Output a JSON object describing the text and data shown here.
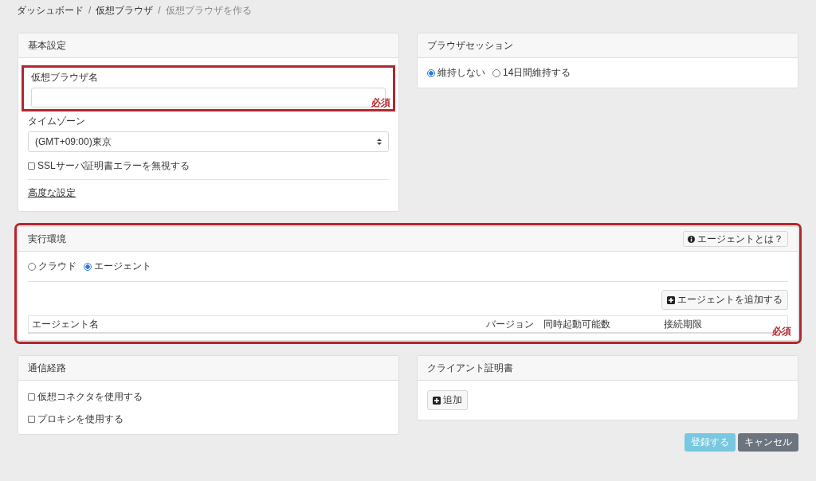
{
  "breadcrumb": {
    "items": [
      {
        "label": "ダッシュボード",
        "link": true
      },
      {
        "label": "仮想ブラウザ",
        "link": true
      },
      {
        "label": "仮想ブラウザを作る",
        "link": false
      }
    ],
    "separators": [
      "/",
      "/"
    ]
  },
  "basic_settings": {
    "title": "基本設定",
    "name_field": {
      "label": "仮想ブラウザ名",
      "highlighted": true,
      "note": "必須"
    },
    "timezone": {
      "label": "タイムゾーン",
      "value": "(GMT+09:00)東京"
    },
    "ignore_ssl": {
      "label": "SSLサーバ証明書エラーを無視する",
      "checked": false
    },
    "advanced_link": "高度な設定"
  },
  "browser_session": {
    "title": "ブラウザセッション",
    "options": [
      {
        "label": "維持しない",
        "selected": true
      },
      {
        "label": "14日間維持する",
        "selected": false
      }
    ]
  },
  "execution_environment": {
    "title": "実行環境",
    "highlighted": true,
    "note": "必須",
    "help_button": "エージェントとは？",
    "options": [
      {
        "label": "クラウド",
        "selected": false
      },
      {
        "label": "エージェント",
        "selected": true
      }
    ],
    "add_button": "エージェントを追加する",
    "columns": [
      "エージェント名",
      "バージョン",
      "同時起動可能数",
      "接続期限"
    ]
  },
  "network_route": {
    "title": "通信経路",
    "options": [
      {
        "label": "仮想コネクタを使用する",
        "checked": false
      },
      {
        "label": "プロキシを使用する",
        "checked": false
      }
    ]
  },
  "client_certificate": {
    "title": "クライアント証明書",
    "add_button": "追加"
  },
  "actions": [
    {
      "label": "登録する",
      "kind": "primary",
      "disabled": true
    },
    {
      "label": "キャンセル",
      "kind": "secondary",
      "disabled": false
    }
  ]
}
